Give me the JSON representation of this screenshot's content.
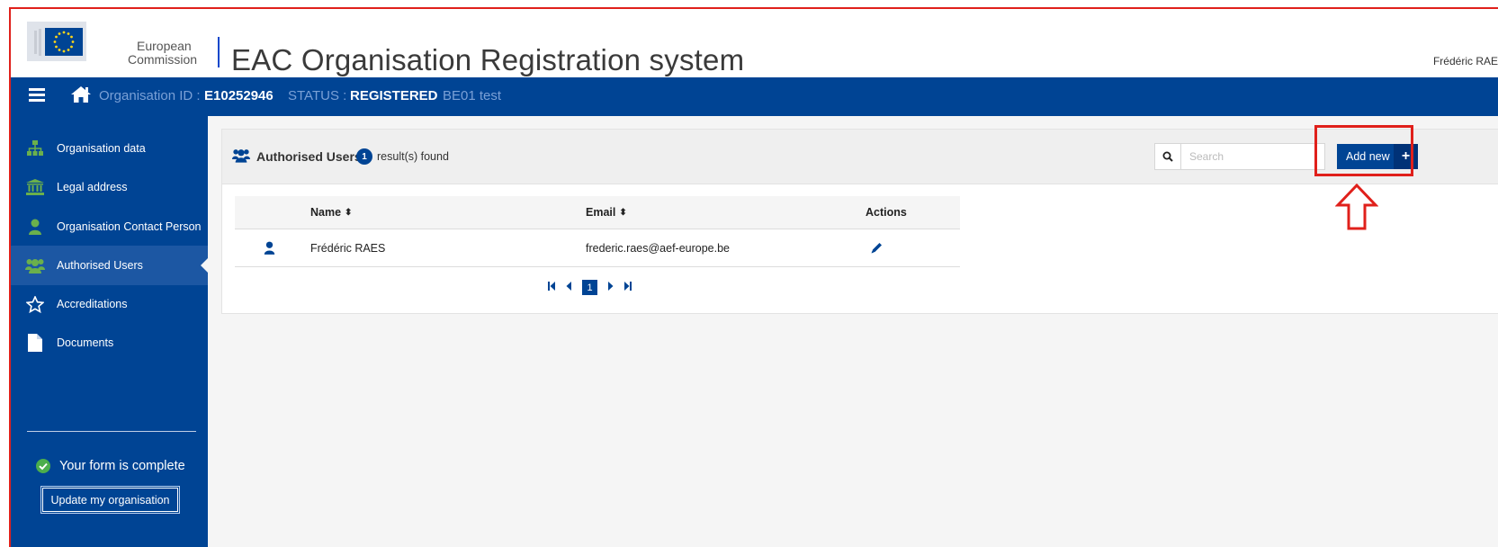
{
  "header": {
    "logo_line1": "European",
    "logo_line2": "Commission",
    "title": "EAC Organisation Registration system",
    "user": "Frédéric RAE"
  },
  "topbar": {
    "org_id_label": "Organisation ID :",
    "org_id_value": "E10252946",
    "status_label": "STATUS :",
    "status_value": "REGISTERED",
    "org_name": "BE01 test"
  },
  "sidebar": {
    "items": [
      {
        "label": "Organisation data",
        "icon": "sitemap-icon"
      },
      {
        "label": "Legal address",
        "icon": "bank-icon"
      },
      {
        "label": "Organisation Contact Person",
        "icon": "user-icon"
      },
      {
        "label": "Authorised Users",
        "icon": "users-icon"
      },
      {
        "label": "Accreditations",
        "icon": "star-icon"
      },
      {
        "label": "Documents",
        "icon": "file-icon"
      }
    ],
    "active_index": 3,
    "complete_text": "Your form is complete",
    "update_button": "Update my organisation"
  },
  "panel": {
    "title": "Authorised Users",
    "count": "1",
    "found_text": "result(s) found",
    "search_placeholder": "Search",
    "add_button": "Add new"
  },
  "table": {
    "columns": {
      "name": "Name",
      "email": "Email",
      "actions": "Actions"
    },
    "rows": [
      {
        "name": "Frédéric RAES",
        "email": "frederic.raes@aef-europe.be"
      }
    ]
  },
  "pager": {
    "current": "1"
  },
  "colors": {
    "primary": "#004494",
    "highlight": "#e0201b",
    "success": "#4cae4c"
  }
}
